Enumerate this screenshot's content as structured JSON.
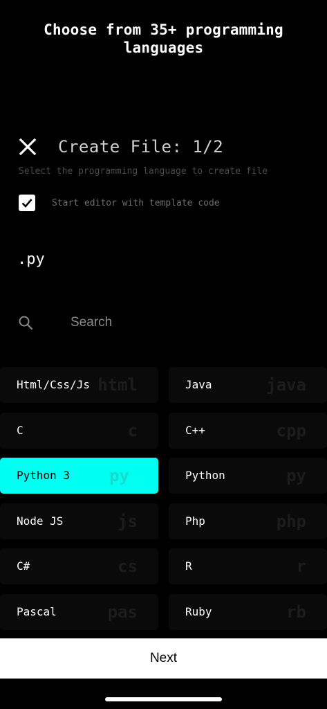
{
  "headline": {
    "line1": "Choose from 35+ programming",
    "line2": "languages"
  },
  "dialog": {
    "title": "Create File: 1/2",
    "subtitle": "Select the programming language to create file",
    "template_label": "Start editor with template code",
    "template_checked": true,
    "extension": ".py"
  },
  "search": {
    "placeholder": "Search",
    "value": ""
  },
  "languages": [
    {
      "name": "Html/Css/Js",
      "ext": "html",
      "selected": false
    },
    {
      "name": "Java",
      "ext": "java",
      "selected": false
    },
    {
      "name": "C",
      "ext": "c",
      "selected": false
    },
    {
      "name": "C++",
      "ext": "cpp",
      "selected": false
    },
    {
      "name": "Python 3",
      "ext": "py",
      "selected": true
    },
    {
      "name": "Python",
      "ext": "py",
      "selected": false
    },
    {
      "name": "Node JS",
      "ext": "js",
      "selected": false
    },
    {
      "name": "Php",
      "ext": "php",
      "selected": false
    },
    {
      "name": "C#",
      "ext": "cs",
      "selected": false
    },
    {
      "name": "R",
      "ext": "r",
      "selected": false
    },
    {
      "name": "Pascal",
      "ext": "pas",
      "selected": false
    },
    {
      "name": "Ruby",
      "ext": "rb",
      "selected": false
    }
  ],
  "next_label": "Next",
  "colors": {
    "accent": "#00fff0",
    "background": "#000000"
  },
  "icons": {
    "close": "close-icon",
    "checkbox": "checkmark-icon",
    "search": "search-icon"
  }
}
